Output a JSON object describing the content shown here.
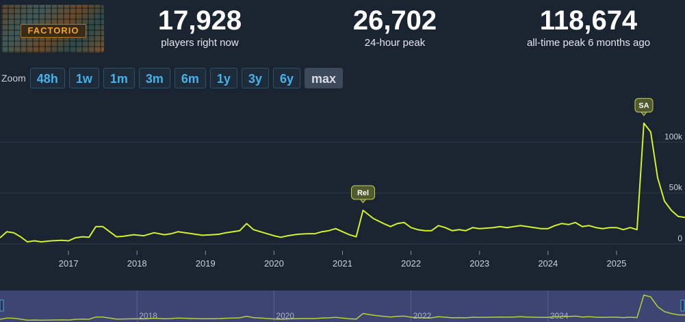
{
  "game_logo_text": "FACTORIO",
  "stats": [
    {
      "value": "17,928",
      "label": "players right now"
    },
    {
      "value": "26,702",
      "label": "24-hour peak"
    },
    {
      "value": "118,674",
      "label": "all-time peak 6 months ago"
    }
  ],
  "zoom": {
    "label": "Zoom",
    "options": [
      "48h",
      "1w",
      "1m",
      "3m",
      "6m",
      "1y",
      "3y",
      "6y",
      "max"
    ],
    "selected": "max"
  },
  "colors": {
    "line": "#d4f230",
    "grid": "#2f3b4a",
    "flag": "#4f5a2e"
  },
  "chart_data": {
    "type": "line",
    "series": [
      {
        "values": [
          [
            2016.0,
            6000
          ],
          [
            2016.1,
            12000
          ],
          [
            2016.2,
            11000
          ],
          [
            2016.3,
            7000
          ],
          [
            2016.4,
            2000
          ],
          [
            2016.5,
            3000
          ],
          [
            2016.6,
            2000
          ],
          [
            2016.75,
            3000
          ],
          [
            2016.9,
            3500
          ],
          [
            2017.0,
            3000
          ],
          [
            2017.1,
            6000
          ],
          [
            2017.2,
            7000
          ],
          [
            2017.3,
            6500
          ],
          [
            2017.4,
            17000
          ],
          [
            2017.5,
            17000
          ],
          [
            2017.6,
            12000
          ],
          [
            2017.7,
            7000
          ],
          [
            2017.8,
            7500
          ],
          [
            2017.95,
            9000
          ],
          [
            2018.1,
            8000
          ],
          [
            2018.25,
            11000
          ],
          [
            2018.4,
            9000
          ],
          [
            2018.5,
            10000
          ],
          [
            2018.6,
            12000
          ],
          [
            2018.8,
            10000
          ],
          [
            2018.95,
            8500
          ],
          [
            2019.1,
            9000
          ],
          [
            2019.2,
            9500
          ],
          [
            2019.3,
            11000
          ],
          [
            2019.4,
            12000
          ],
          [
            2019.5,
            13000
          ],
          [
            2019.6,
            20000
          ],
          [
            2019.7,
            14000
          ],
          [
            2019.85,
            11000
          ],
          [
            2020.0,
            8000
          ],
          [
            2020.1,
            6500
          ],
          [
            2020.2,
            8000
          ],
          [
            2020.35,
            9500
          ],
          [
            2020.5,
            10000
          ],
          [
            2020.6,
            10000
          ],
          [
            2020.7,
            12000
          ],
          [
            2020.8,
            13000
          ],
          [
            2020.9,
            15000
          ],
          [
            2021.0,
            12000
          ],
          [
            2021.1,
            9000
          ],
          [
            2021.2,
            7000
          ],
          [
            2021.3,
            33000
          ],
          [
            2021.45,
            25000
          ],
          [
            2021.6,
            20000
          ],
          [
            2021.7,
            17000
          ],
          [
            2021.8,
            20000
          ],
          [
            2021.9,
            21000
          ],
          [
            2022.0,
            16000
          ],
          [
            2022.1,
            14000
          ],
          [
            2022.2,
            13000
          ],
          [
            2022.3,
            13000
          ],
          [
            2022.4,
            18000
          ],
          [
            2022.5,
            16000
          ],
          [
            2022.6,
            13000
          ],
          [
            2022.7,
            14000
          ],
          [
            2022.8,
            13000
          ],
          [
            2022.9,
            16000
          ],
          [
            2023.0,
            15000
          ],
          [
            2023.1,
            15500
          ],
          [
            2023.2,
            16000
          ],
          [
            2023.3,
            17000
          ],
          [
            2023.4,
            16000
          ],
          [
            2023.5,
            17000
          ],
          [
            2023.6,
            18000
          ],
          [
            2023.7,
            17000
          ],
          [
            2023.8,
            16000
          ],
          [
            2023.9,
            15000
          ],
          [
            2024.0,
            15000
          ],
          [
            2024.1,
            18000
          ],
          [
            2024.2,
            20000
          ],
          [
            2024.3,
            19000
          ],
          [
            2024.4,
            21000
          ],
          [
            2024.5,
            17000
          ],
          [
            2024.6,
            18000
          ],
          [
            2024.7,
            16000
          ],
          [
            2024.8,
            15000
          ],
          [
            2024.9,
            16000
          ],
          [
            2025.0,
            16000
          ],
          [
            2025.1,
            14000
          ],
          [
            2025.2,
            16000
          ],
          [
            2025.3,
            14000
          ],
          [
            2025.4,
            118674
          ],
          [
            2025.5,
            110000
          ],
          [
            2025.6,
            65000
          ],
          [
            2025.7,
            42000
          ],
          [
            2025.8,
            33000
          ],
          [
            2025.9,
            27000
          ],
          [
            2026.0,
            26000
          ]
        ]
      }
    ],
    "xticks": [
      "2017",
      "2018",
      "2019",
      "2020",
      "2021",
      "2022",
      "2023",
      "2024",
      "2025"
    ],
    "yticks": [
      "0",
      "50k",
      "100k"
    ],
    "xlim": [
      2016.0,
      2026.0
    ],
    "ylim": [
      0,
      140000
    ],
    "grid": true,
    "annotations": [
      {
        "label": "Rel",
        "x": 2021.3
      },
      {
        "label": "SA",
        "x": 2025.4
      }
    ],
    "navigator_ticks": [
      "2018",
      "2020",
      "2022",
      "2024"
    ]
  }
}
